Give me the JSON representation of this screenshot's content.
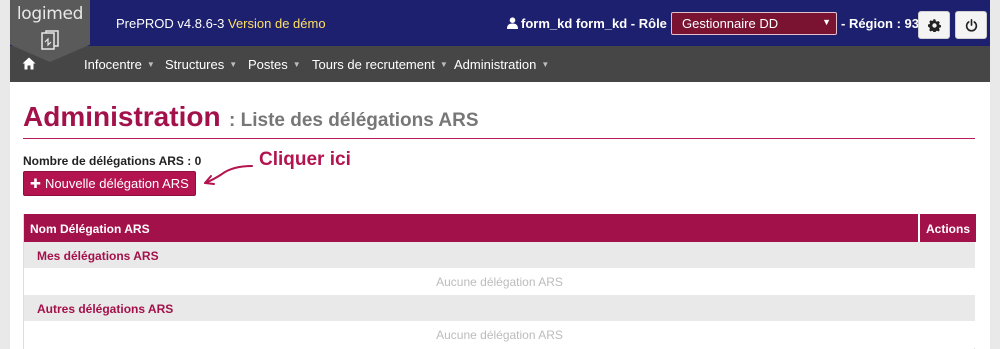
{
  "colors": {
    "topbar": "#1d1f6f",
    "navbar": "#464646",
    "accent": "#a3114a",
    "demo": "#ffe066"
  },
  "header": {
    "logo_text": "logimed",
    "app_version": "PrePROD v4.8.6-3",
    "demo_label": "Version de démo",
    "user_label": "form_kd form_kd - Rôle :",
    "role_selected": "Gestionnaire DD",
    "region_label": "- Région : 93",
    "icons": [
      "user-icon",
      "gear-icon",
      "power-icon"
    ]
  },
  "nav": {
    "home_icon": "home-icon",
    "items": [
      {
        "label": "Infocentre"
      },
      {
        "label": "Structures"
      },
      {
        "label": "Postes"
      },
      {
        "label": "Tours de recrutement"
      },
      {
        "label": "Administration"
      }
    ]
  },
  "page": {
    "title": "Administration",
    "subtitle": ": Liste des délégations ARS",
    "count_label": "Nombre de délégations ARS : 0",
    "new_button_label": "Nouvelle délégation ARS",
    "annotation": "Cliquer ici"
  },
  "table": {
    "columns": [
      "Nom Délégation ARS",
      "Actions"
    ],
    "groups": [
      {
        "label": "Mes délégations ARS",
        "empty_text": "Aucune délégation ARS"
      },
      {
        "label": "Autres délégations ARS",
        "empty_text": "Aucune délégation ARS"
      }
    ]
  }
}
